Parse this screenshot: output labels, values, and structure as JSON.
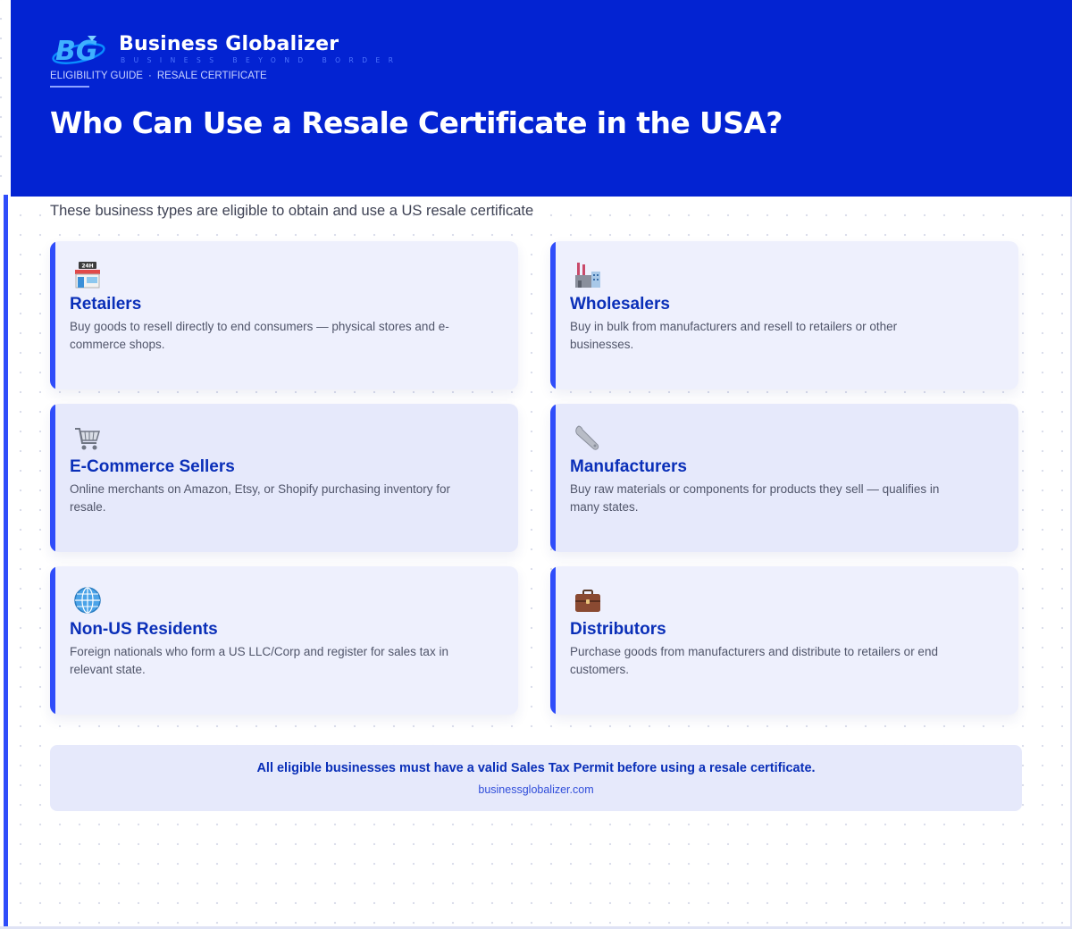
{
  "brand": {
    "name": "Business Globalizer",
    "tagline": "BUSINESS BEYOND BORDER",
    "logo_text": "BG"
  },
  "breadcrumb": {
    "section": "ELIGIBILITY GUIDE",
    "separator": "·",
    "topic": "RESALE CERTIFICATE"
  },
  "page_title": "Who Can Use a Resale Certificate in the USA?",
  "intro": "These business types are eligible to obtain and use a US resale certificate",
  "cards": [
    {
      "icon": "store-24h-icon",
      "title": "Retailers",
      "description": "Buy goods to resell directly to end consumers — physical stores and e-commerce shops."
    },
    {
      "icon": "factory-icon",
      "title": "Wholesalers",
      "description": "Buy in bulk from manufacturers and resell to retailers or other businesses."
    },
    {
      "icon": "shopping-cart-icon",
      "title": "E-Commerce Sellers",
      "description": "Online merchants on Amazon, Etsy, or Shopify purchasing inventory for resale."
    },
    {
      "icon": "wrench-icon",
      "title": "Manufacturers",
      "description": "Buy raw materials or components for products they sell — qualifies in many states."
    },
    {
      "icon": "globe-icon",
      "title": "Non-US Residents",
      "description": "Foreign nationals who form a US LLC/Corp and register for sales tax in relevant state."
    },
    {
      "icon": "briefcase-icon",
      "title": "Distributors",
      "description": "Purchase goods from manufacturers and distribute to retailers or end customers."
    }
  ],
  "footer": {
    "note": "All eligible businesses must have a valid Sales Tax Permit before using a resale certificate.",
    "site": "businessglobalizer.com"
  },
  "colors": {
    "header_bg": "#0323d2",
    "accent": "#2f4dfa",
    "title_blue": "#0a2fb8",
    "card_bg": "#eef0fd"
  }
}
